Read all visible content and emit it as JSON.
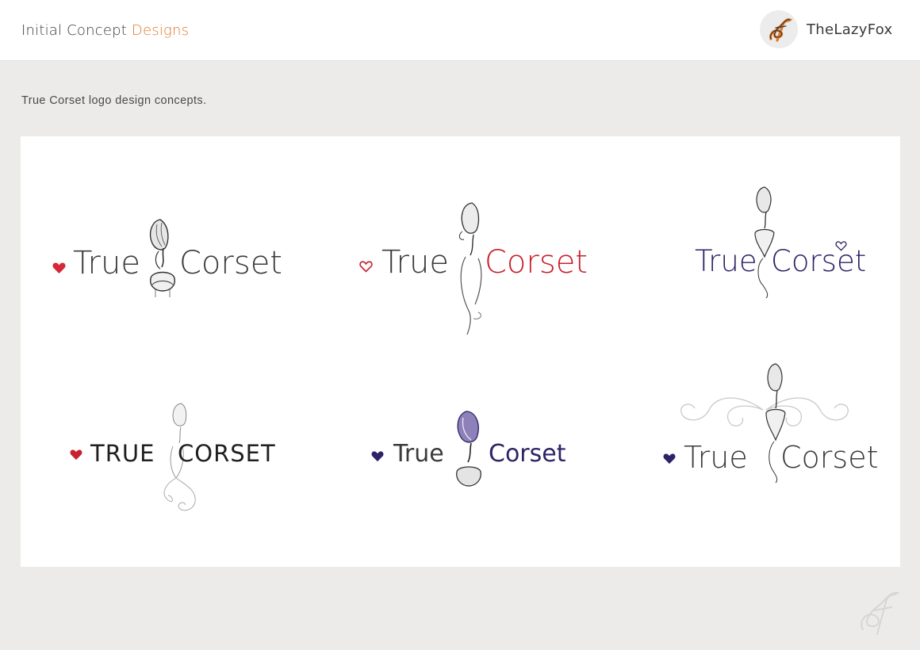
{
  "header": {
    "title_prefix": "Initial Concept",
    "title_accent": "Designs",
    "brand_name": "TheLazyFox",
    "brand_logo_icon": "fox-f-logo-icon",
    "accent_color": "#e07a28"
  },
  "intro_text": "True Corset logo design concepts.",
  "concepts": [
    {
      "word1": "True",
      "word2": "Corset",
      "text_color": "#3b3b3b",
      "accent_color": "#d62839",
      "heart": "filled-heart-icon",
      "style": "thin-sans"
    },
    {
      "word1": "True",
      "word2": "Corset",
      "text_color": "#3b3b3b",
      "accent_color": "#c8202e",
      "heart": "outline-heart-icon",
      "style": "thin-sans"
    },
    {
      "word1": "True",
      "word2": "Corset",
      "text_color": "#2c2466",
      "accent_color": "#2c2466",
      "heart": "outline-heart-icon",
      "style": "sans"
    },
    {
      "word1": "TRUE",
      "word2": "CORSET",
      "text_color": "#1f1f1f",
      "accent_color": "#c8202e",
      "heart": "filled-heart-icon",
      "style": "deco-caps"
    },
    {
      "word1": "True",
      "word2": "Corset",
      "text_color": "#3b3b3b",
      "accent_color": "#2c2466",
      "heart": "filled-heart-icon",
      "style": "rounded"
    },
    {
      "word1": "True",
      "word2": "Corset",
      "text_color": "#3b3b3b",
      "accent_color": "#2c2466",
      "heart": "filled-heart-icon",
      "style": "thin-sans-ornate"
    }
  ],
  "footer_mark_icon": "fox-f-watermark-icon"
}
